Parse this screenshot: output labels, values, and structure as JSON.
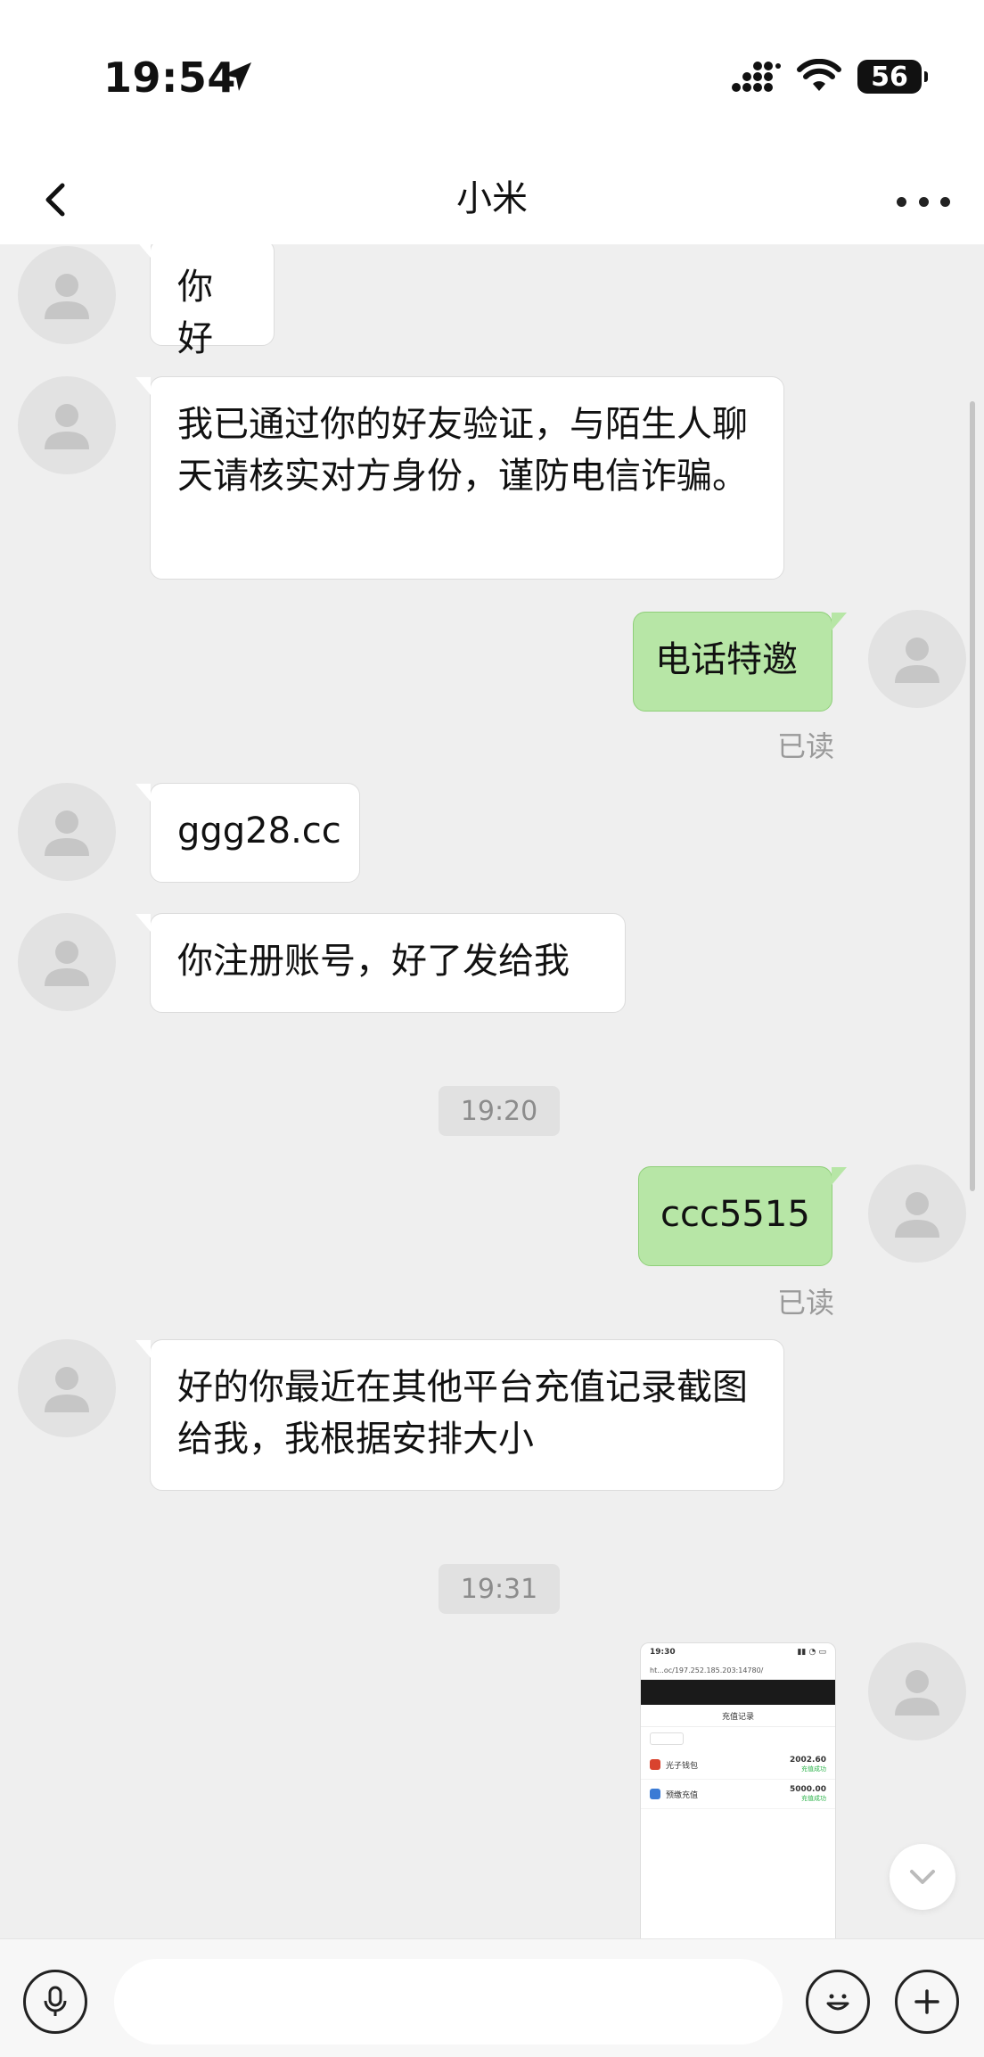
{
  "status_bar": {
    "time": "19:54",
    "battery": "56"
  },
  "header": {
    "title": "小米"
  },
  "messages": [
    {
      "side": "in",
      "text": "你好"
    },
    {
      "side": "in",
      "text": "我已通过你的好友验证，与陌生人聊天请核实对方身份，谨防电信诈骗。"
    },
    {
      "side": "out",
      "text": "电话特邀",
      "status": "已读"
    },
    {
      "side": "in",
      "text": "ggg28.cc"
    },
    {
      "side": "in",
      "text": "你注册账号，好了发给我"
    },
    {
      "type": "time",
      "text": "19:20"
    },
    {
      "side": "out",
      "text": "ccc5515",
      "status": "已读"
    },
    {
      "side": "in",
      "text": "好的你最近在其他平台充值记录截图给我，我根据安排大小"
    },
    {
      "type": "time",
      "text": "19:31"
    },
    {
      "side": "out",
      "type": "image"
    }
  ],
  "screenshot_thumb": {
    "time": "19:30",
    "url": "ht...oc/197.252.185.203:14780/",
    "title": "充值记录",
    "rows": [
      {
        "name": "光子钱包",
        "amount": "2002.60",
        "status": "充值成功"
      },
      {
        "name": "预缴充值",
        "amount": "5000.00",
        "status": "充值成功"
      }
    ]
  },
  "colors": {
    "outgoing_bubble": "#b7e6a6",
    "incoming_bubble": "#ffffff",
    "background": "#efefef"
  },
  "icons": [
    "location-arrow-icon",
    "signal-icon",
    "wifi-icon",
    "battery-icon",
    "back-chevron-icon",
    "more-dots-icon",
    "avatar-placeholder-icon",
    "chevron-down-icon",
    "microphone-icon",
    "emoji-icon",
    "plus-icon"
  ]
}
